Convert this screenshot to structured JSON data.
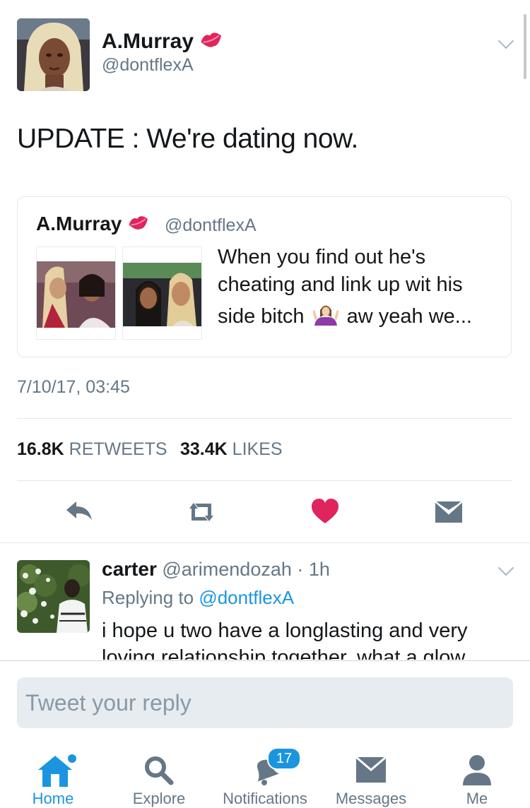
{
  "tweet": {
    "display_name": "A.Murray",
    "handle": "@dontflexA",
    "text": "UPDATE : We're dating now.",
    "timestamp": "7/10/17, 03:45",
    "retweets_count": "16.8K",
    "retweets_label": "RETWEETS",
    "likes_count": "33.4K",
    "likes_label": "LIKES"
  },
  "quoted_tweet": {
    "display_name": "A.Murray",
    "handle": "@dontflexA",
    "text_line1": "When you find out he's",
    "text_line2": "cheating and link up wit his",
    "text_line3a": "side bitch",
    "text_line3b": "aw yeah we..."
  },
  "reply": {
    "display_name": "carter",
    "handle": "@arimendozah",
    "time": "· 1h",
    "replying_to_prefix": "Replying to",
    "replying_to_handle": "@dontflexA",
    "text_line1": "i hope u two have a longlasting and very",
    "text_line2": "loving relationship together. what a glow"
  },
  "composer": {
    "placeholder": "Tweet your reply"
  },
  "tabbar": {
    "home": "Home",
    "explore": "Explore",
    "notifications": "Notifications",
    "notifications_badge": "17",
    "messages": "Messages",
    "me": "Me"
  },
  "colors": {
    "accent": "#1b95e0",
    "like": "#e0245e",
    "muted": "#657786"
  }
}
